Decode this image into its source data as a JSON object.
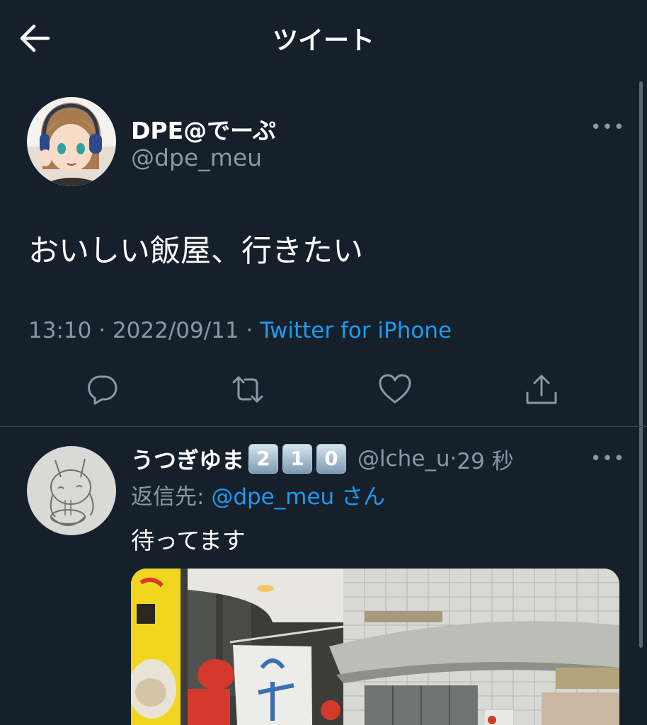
{
  "header": {
    "title": "ツイート",
    "back_icon": "arrow-left-icon"
  },
  "tweet": {
    "author_name": "DPE@でーぷ",
    "author_handle": "@dpe_meu",
    "text": "おいしい飯屋、行きたい",
    "time": "13:10",
    "date": "2022/09/11",
    "source": "Twitter for iPhone",
    "actions": [
      "reply-icon",
      "retweet-icon",
      "like-icon",
      "share-icon"
    ]
  },
  "reply": {
    "author_name": "うつぎゆま",
    "keycaps": [
      "2",
      "1",
      "0"
    ],
    "author_handle": "@lche_u",
    "time": "29 秒",
    "reply_to_label": "返信先:",
    "reply_to_handle": "@dpe_meu",
    "reply_to_suffix": "さん",
    "text": "待ってます"
  },
  "colors": {
    "background": "#15202b",
    "accent": "#1d9bf0",
    "secondary_text": "#8899a6",
    "divider": "#38444d"
  }
}
